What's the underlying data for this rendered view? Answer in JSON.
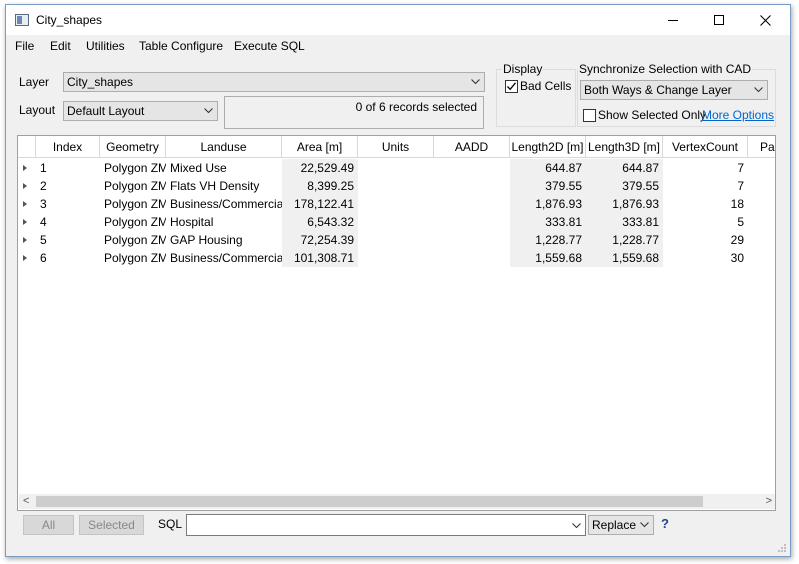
{
  "window": {
    "title": "City_shapes",
    "icon": "window-app-icon"
  },
  "menu": [
    "File",
    "Edit",
    "Utilities",
    "Table Configure",
    "Execute SQL"
  ],
  "layer": {
    "label": "Layer",
    "value": "City_shapes"
  },
  "layout": {
    "label": "Layout",
    "value": "Default Layout"
  },
  "records_status": "0 of 6 records selected",
  "display": {
    "title": "Display",
    "bad_cells_label": "Bad Cells",
    "bad_cells_checked": true
  },
  "sync": {
    "title": "Synchronize Selection with CAD",
    "mode": "Both Ways & Change Layer",
    "show_selected_label": "Show Selected Only",
    "show_selected_checked": false,
    "more_options": "More Options"
  },
  "table": {
    "columns": [
      "Index",
      "Geometry",
      "Landuse",
      "Area [m]",
      "Units",
      "AADD",
      "Length2D [m]",
      "Length3D [m]",
      "VertexCount",
      "Par"
    ],
    "rows": [
      {
        "index": "1",
        "geometry": "Polygon ZM",
        "landuse": "Mixed Use",
        "area": "22,529.49",
        "units": "",
        "aadd": "",
        "len2d": "644.87",
        "len3d": "644.87",
        "vertex": "7"
      },
      {
        "index": "2",
        "geometry": "Polygon ZM",
        "landuse": "Flats VH Density",
        "area": "8,399.25",
        "units": "",
        "aadd": "",
        "len2d": "379.55",
        "len3d": "379.55",
        "vertex": "7"
      },
      {
        "index": "3",
        "geometry": "Polygon ZM",
        "landuse": "Business/Commercial",
        "area": "178,122.41",
        "units": "",
        "aadd": "",
        "len2d": "1,876.93",
        "len3d": "1,876.93",
        "vertex": "18"
      },
      {
        "index": "4",
        "geometry": "Polygon ZM",
        "landuse": "Hospital",
        "area": "6,543.32",
        "units": "",
        "aadd": "",
        "len2d": "333.81",
        "len3d": "333.81",
        "vertex": "5"
      },
      {
        "index": "5",
        "geometry": "Polygon ZM",
        "landuse": "GAP Housing",
        "area": "72,254.39",
        "units": "",
        "aadd": "",
        "len2d": "1,228.77",
        "len3d": "1,228.77",
        "vertex": "29"
      },
      {
        "index": "6",
        "geometry": "Polygon ZM",
        "landuse": "Business/Commercial",
        "area": "101,308.71",
        "units": "",
        "aadd": "",
        "len2d": "1,559.68",
        "len3d": "1,559.68",
        "vertex": "30"
      }
    ]
  },
  "bottom": {
    "all_label": "All",
    "selected_label": "Selected",
    "sql_label": "SQL",
    "sql_value": "",
    "replace_value": "Replace",
    "help": "?"
  }
}
